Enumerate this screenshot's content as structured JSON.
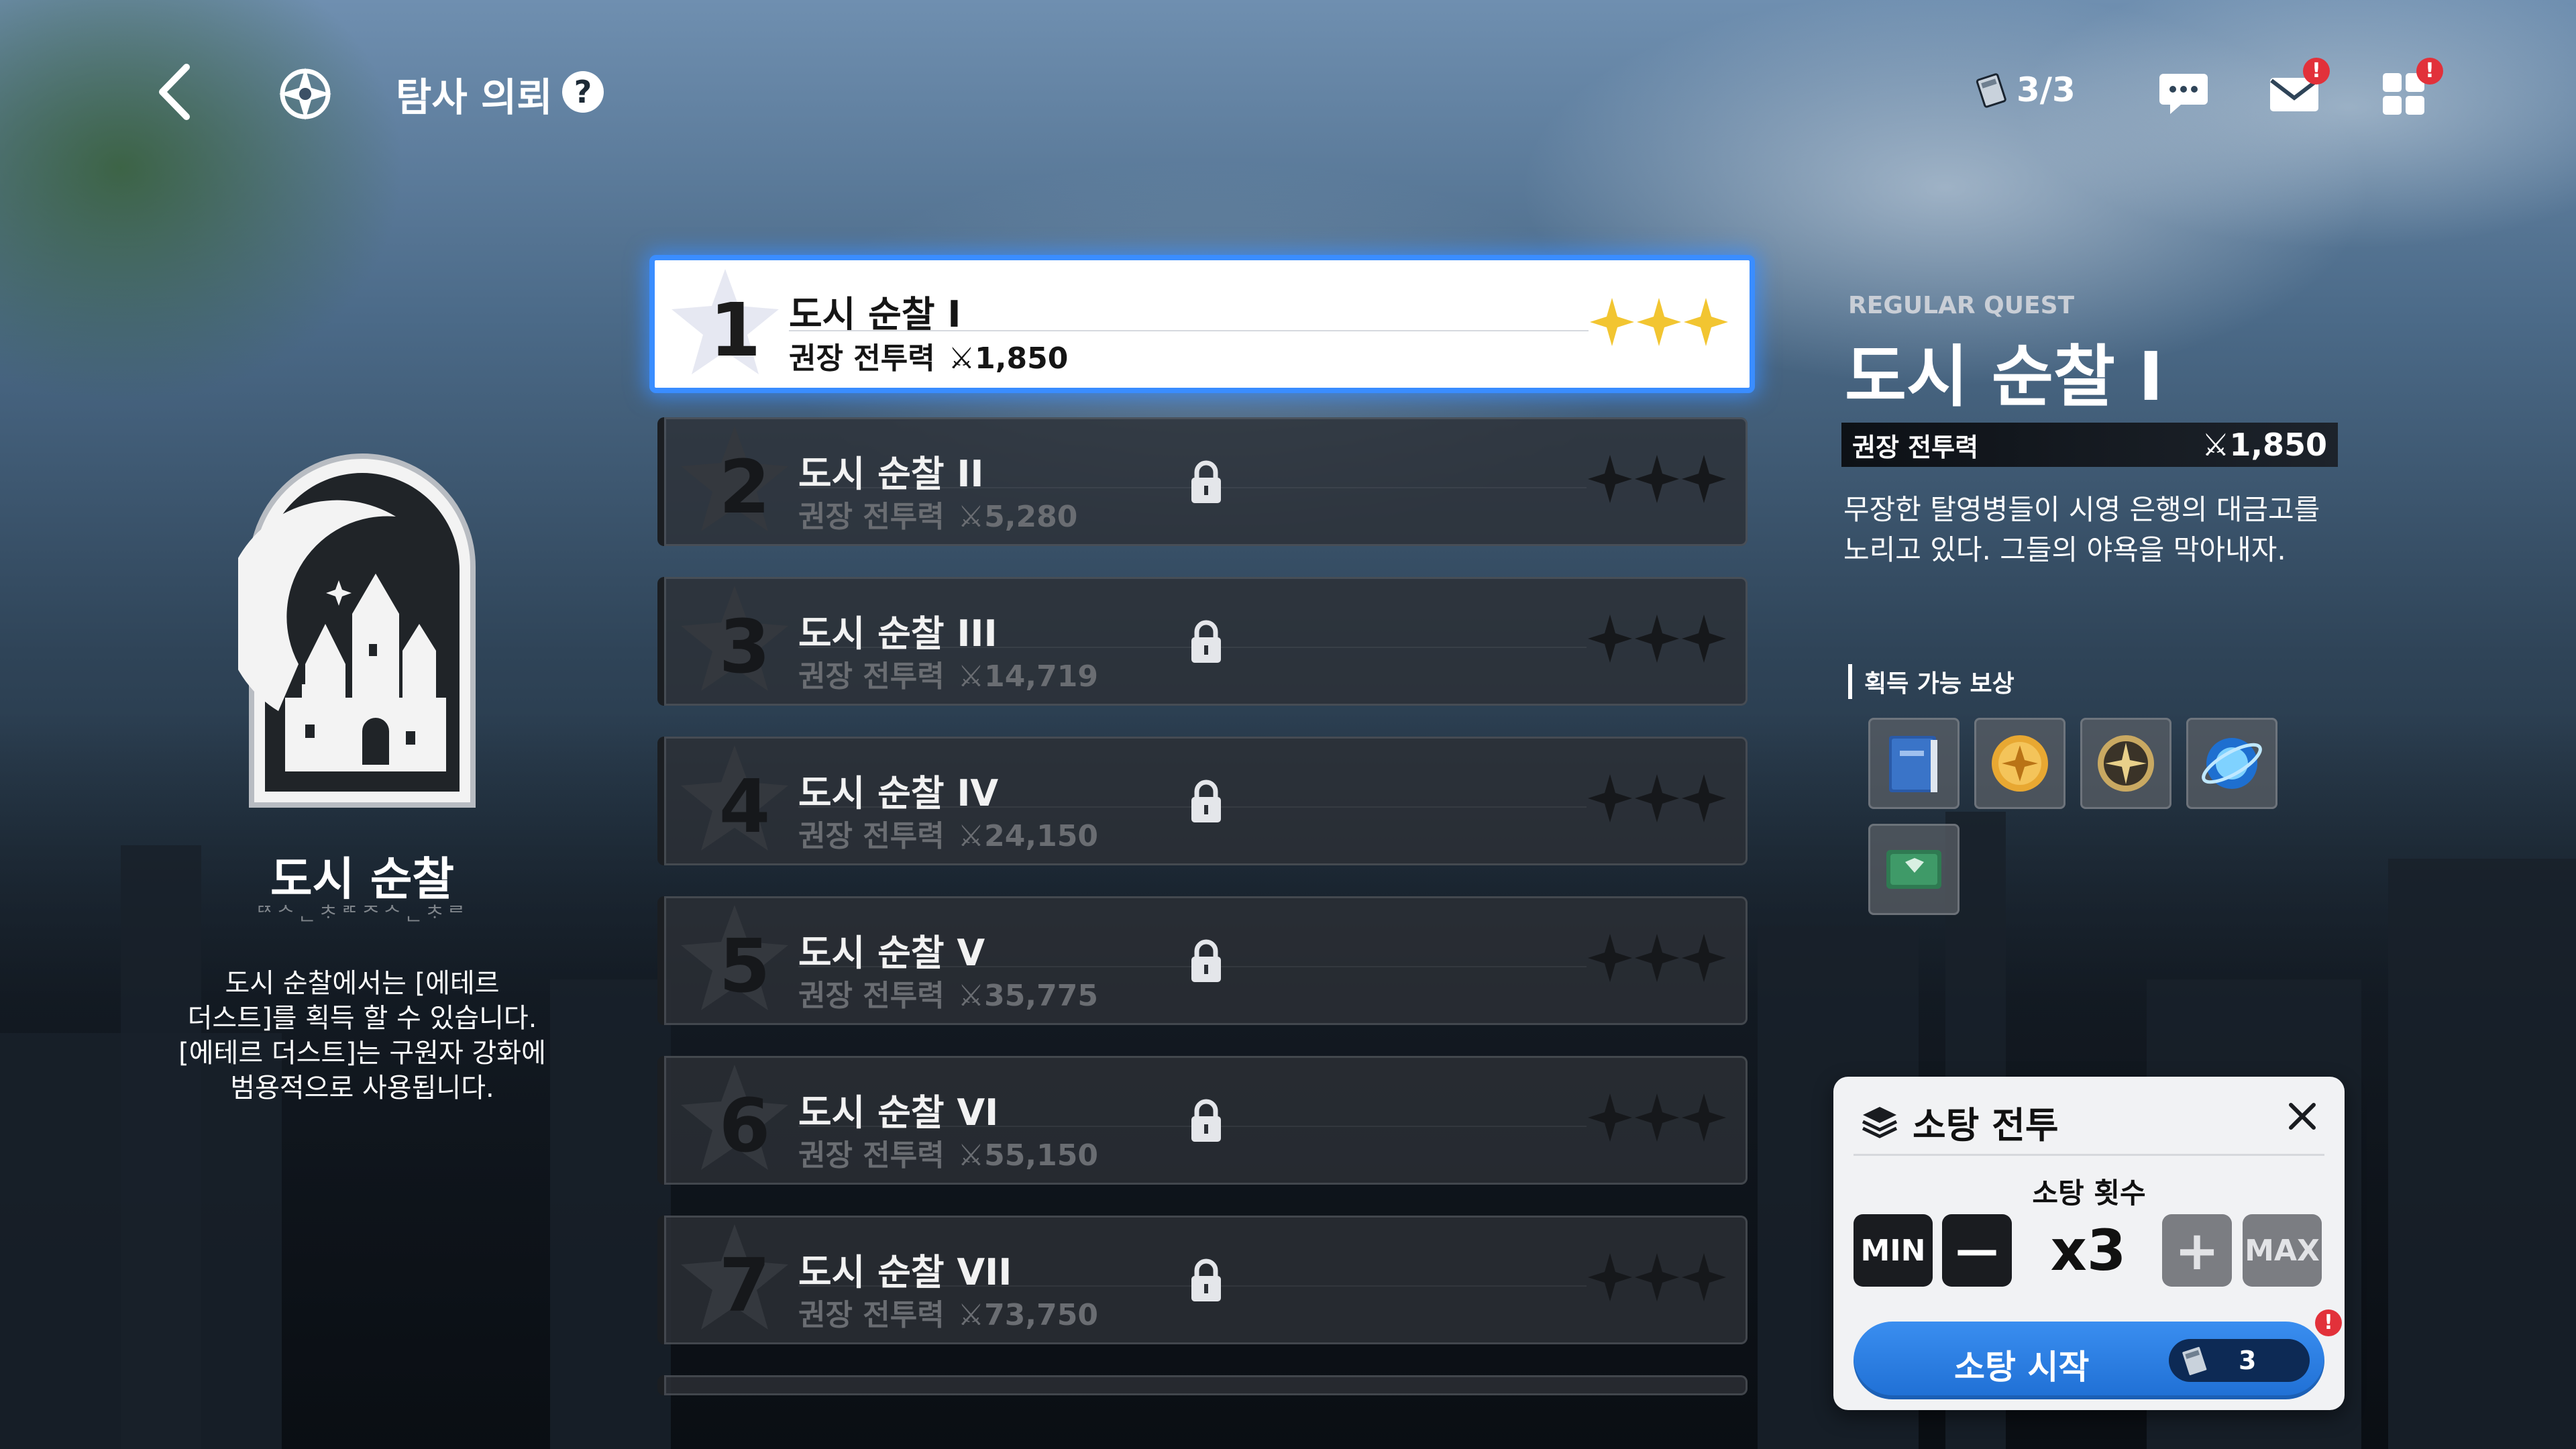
{
  "header": {
    "back_icon": "chevron-left-icon",
    "emblem_icon": "compass-star-icon",
    "title": "탐사 의뢰",
    "help": "?",
    "stamina": "3/3",
    "chat_icon": "chat-bubble-icon",
    "mail_icon": "mail-icon",
    "menu_icon": "grid-menu-icon",
    "alert_badge": "!"
  },
  "category": {
    "name": "도시 순찰",
    "subtitle": "ᄃᄌᄉᆫᄎᆞᄅᄃᄌᄉᆫᄎᆞᄅ",
    "description_lines": [
      "도시 순찰에서는 [에테르",
      "더스트]를 획득 할 수 있습니다.",
      "[에테르 더스트]는 구원자 강화에",
      "범용적으로 사용됩니다."
    ]
  },
  "power_label": "권장 전투력",
  "stages": [
    {
      "num": "1",
      "name": "도시 순찰 I",
      "power": "1,850",
      "locked": false,
      "selected": true
    },
    {
      "num": "2",
      "name": "도시 순찰 II",
      "power": "5,280",
      "locked": true,
      "selected": false
    },
    {
      "num": "3",
      "name": "도시 순찰 III",
      "power": "14,719",
      "locked": true,
      "selected": false
    },
    {
      "num": "4",
      "name": "도시 순찰 IV",
      "power": "24,150",
      "locked": true,
      "selected": false
    },
    {
      "num": "5",
      "name": "도시 순찰 V",
      "power": "35,775",
      "locked": true,
      "selected": false
    },
    {
      "num": "6",
      "name": "도시 순찰 VI",
      "power": "55,150",
      "locked": true,
      "selected": false
    },
    {
      "num": "7",
      "name": "도시 순찰 VII",
      "power": "73,750",
      "locked": true,
      "selected": false
    }
  ],
  "detail": {
    "tag": "REGULAR QUEST",
    "title": "도시 순찰 I",
    "power_label": "권장 전투력",
    "power": "1,850",
    "desc_lines": [
      "무장한 탈영병들이 시영 은행의 대금고를",
      "노리고 있다. 그들의 야욕을 막아내자."
    ],
    "rewards_label": "획득 가능 보상",
    "rewards": [
      "blue-book-icon",
      "gold-coin-icon",
      "compass-medal-icon",
      "ether-orb-icon",
      "green-card-icon"
    ]
  },
  "sweep": {
    "title": "소탕 전투",
    "count_label": "소탕 횟수",
    "min": "MIN",
    "max": "MAX",
    "minus": "—",
    "plus": "+",
    "count": "x3",
    "start": "소탕 시작",
    "cost": "3",
    "alert": "!"
  },
  "colors": {
    "accent": "#3a8dff",
    "star_gold": "#f2c531",
    "alert_red": "#e2313a",
    "start_blue": "#2a7ee6"
  }
}
